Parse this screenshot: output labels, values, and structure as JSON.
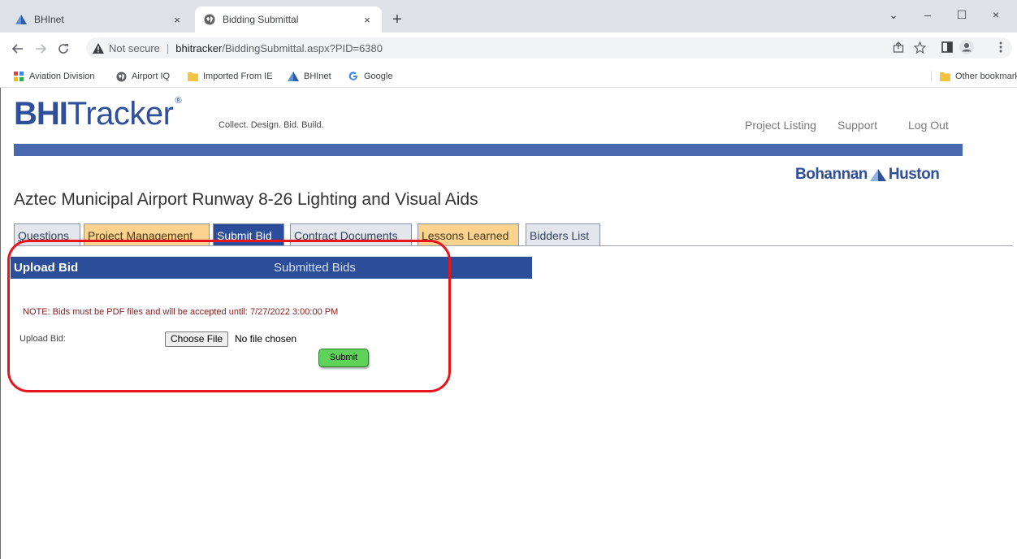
{
  "browser": {
    "tabs": [
      {
        "title": "BHInet",
        "active": false
      },
      {
        "title": "Bidding Submittal",
        "active": true
      }
    ],
    "new_tab_symbol": "+",
    "close_symbol": "×",
    "window_controls": {
      "chevron": "⌄",
      "minimize": "–",
      "maximize": "☐",
      "close": "×"
    },
    "address": {
      "security_label": "Not secure",
      "separator": "|",
      "host": "bhitracker",
      "path": "/BiddingSubmittal.aspx?PID=6380"
    },
    "bookmarks": [
      "Aviation Division",
      "Airport IQ",
      "Imported From IE",
      "BHInet",
      "Google"
    ],
    "other_bookmarks": "Other bookmarks"
  },
  "site": {
    "logo_bold": "BHI",
    "logo_regular": "Tracker",
    "logo_mark": "®",
    "tagline": "Collect.  Design.  Bid.  Build.",
    "nav": [
      "Project Listing",
      "Support",
      "Log Out"
    ],
    "company_left": "Bohannan",
    "company_right": "Huston"
  },
  "project": {
    "title": "Aztec Municipal Airport Runway 8-26 Lighting and Visual Aids"
  },
  "page_tabs": [
    {
      "label": "Questions",
      "style": "grey"
    },
    {
      "label": "Project Management",
      "style": "orange"
    },
    {
      "label": "Submit Bid",
      "style": "active"
    },
    {
      "label": "Contract Documents",
      "style": "grey"
    },
    {
      "label": "Lessons Learned",
      "style": "orange"
    },
    {
      "label": "Bidders List",
      "style": "grey"
    }
  ],
  "panel": {
    "upload_bid_heading": "Upload Bid",
    "submitted_bids_heading": "Submitted Bids",
    "note": "NOTE: Bids must be PDF files and will be accepted until: 7/27/2022 3:00:00 PM",
    "upload_label": "Upload Bid:",
    "choose_file": "Choose File",
    "no_file": "No file chosen",
    "submit": "Submit"
  },
  "colors": {
    "brand_blue": "#2b4d9a",
    "bar_blue": "#4a68b0",
    "orange_tab": "#fbd38e",
    "submit_green": "#5ed35a",
    "annotation_red": "#e8141c"
  }
}
